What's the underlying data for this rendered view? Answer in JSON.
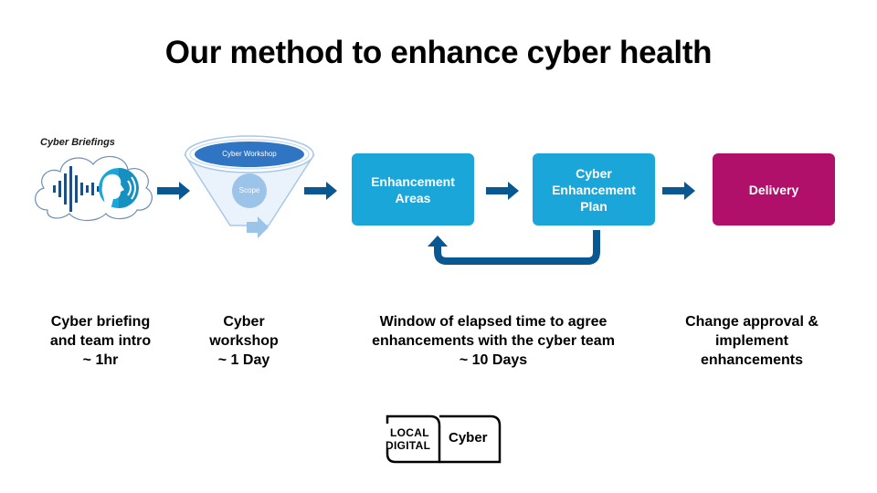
{
  "title": "Our method to enhance cyber health",
  "stages": {
    "briefing": {
      "image_label": "Cyber Briefings",
      "icon": "voice-sound-wave-icon"
    },
    "workshop": {
      "funnel_top_label": "Cyber Workshop",
      "funnel_inner_label": "Scope"
    },
    "enhancement_areas": {
      "label": "Enhancement\nAreas",
      "color": "#1ba6d9"
    },
    "enhancement_plan": {
      "label": "Cyber\nEnhancement\nPlan",
      "color": "#1ba6d9"
    },
    "delivery": {
      "label": "Delivery",
      "color": "#b0106a"
    }
  },
  "arrow_color": "#0a5891",
  "captions": [
    "Cyber briefing\nand team intro\n~ 1hr",
    "Cyber\nworkshop\n~ 1 Day",
    "Window of elapsed time to agree\nenhancements with the cyber team\n~ 10 Days",
    "Change approval &\nimplement\nenhancements"
  ],
  "logo": {
    "left_line1": "LOCAL",
    "left_line2": "DIGITAL",
    "right": "Cyber"
  }
}
